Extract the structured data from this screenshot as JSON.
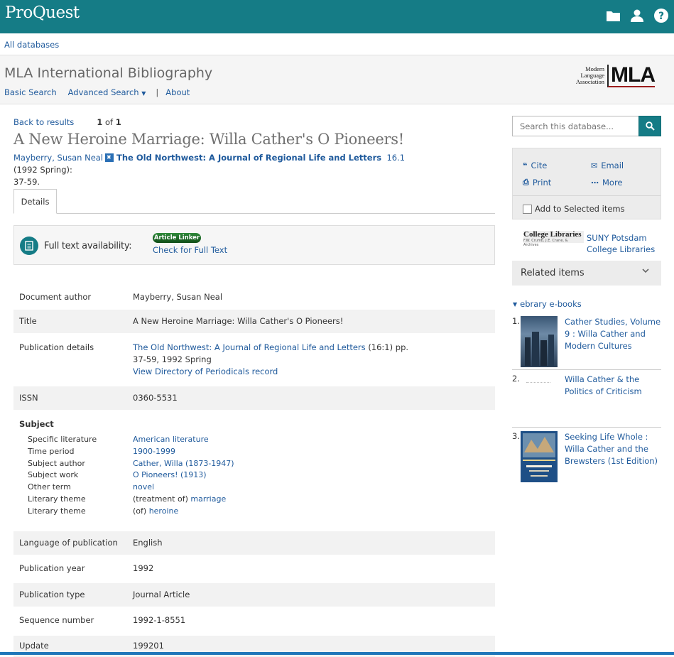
{
  "header": {
    "logo": "ProQuest",
    "icons": [
      "folder-icon",
      "user-icon",
      "help-icon"
    ]
  },
  "topnav": {
    "all_databases": "All databases"
  },
  "database": {
    "title": "MLA International Bibliography",
    "nav": {
      "basic": "Basic Search",
      "advanced": "Advanced Search",
      "about": "About"
    },
    "logo_small": [
      "Modern",
      "Language",
      "Association"
    ],
    "logo_big": "MLA"
  },
  "results": {
    "back": "Back to results",
    "position": "1",
    "of": "of",
    "total": "1"
  },
  "article": {
    "title": "A New Heroine Marriage: Willa Cather's O Pioneers!",
    "author": "Mayberry, Susan Neal",
    "journal": "The Old Northwest: A Journal of Regional Life and Letters",
    "volume": "16.1",
    "issue_info": "(1992 Spring):",
    "pages": "37-59."
  },
  "tabs": {
    "details": "Details"
  },
  "fulltext": {
    "label": "Full text availability:",
    "linker": "Article Linker",
    "check": "Check for Full Text"
  },
  "details": {
    "author_label": "Document author",
    "author_value": "Mayberry, Susan Neal",
    "title_label": "Title",
    "title_value": "A New Heroine Marriage: Willa Cather's O Pioneers!",
    "pub_label": "Publication details",
    "pub_journal": "The Old Northwest: A Journal of Regional Life and Letters",
    "pub_suffix": "(16:1) pp.",
    "pub_line2": "37-59, 1992 Spring",
    "pub_dir": "View Directory of Periodicals record",
    "issn_label": "ISSN",
    "issn_value": "0360-5531",
    "subject_label": "Subject",
    "subjects": [
      {
        "label": "Specific literature",
        "prefix": "",
        "value": "American literature"
      },
      {
        "label": "Time period",
        "prefix": "",
        "value": "1900-1999"
      },
      {
        "label": "Subject author",
        "prefix": "",
        "value": "Cather, Willa (1873-1947)"
      },
      {
        "label": "Subject work",
        "prefix": "",
        "value": "O Pioneers! (1913)"
      },
      {
        "label": "Other term",
        "prefix": "",
        "value": "novel"
      },
      {
        "label": "Literary theme",
        "prefix": "(treatment of)",
        "value": "marriage"
      },
      {
        "label": "Literary theme",
        "prefix": "(of)",
        "value": "heroine"
      }
    ],
    "lang_label": "Language of publication",
    "lang_value": "English",
    "year_label": "Publication year",
    "year_value": "1992",
    "type_label": "Publication type",
    "type_value": "Journal Article",
    "seq_label": "Sequence number",
    "seq_value": "1992-1-8551",
    "update_label": "Update",
    "update_value": "199201"
  },
  "sidebar": {
    "search_placeholder": "Search this database...",
    "cite": "Cite",
    "email": "Email",
    "print": "Print",
    "more": "More",
    "add_selected": "Add to Selected items",
    "college_logo": "College Libraries",
    "college_logo_sub": "F.W. Crumb, J.E. Crane, & Archives",
    "library_line1": "SUNY Potsdam",
    "library_line2": "College Libraries",
    "related_title": "Related items",
    "ebrary": "ebrary e-books",
    "related_items": [
      {
        "num": "1.",
        "title": "Cather Studies, Volume 9 : Willa Cather and Modern Cultures"
      },
      {
        "num": "2.",
        "title": "Willa Cather & the Politics of Criticism"
      },
      {
        "num": "3.",
        "title": "Seeking Life Whole : Willa Cather and the Brewsters (1st Edition)"
      }
    ]
  }
}
